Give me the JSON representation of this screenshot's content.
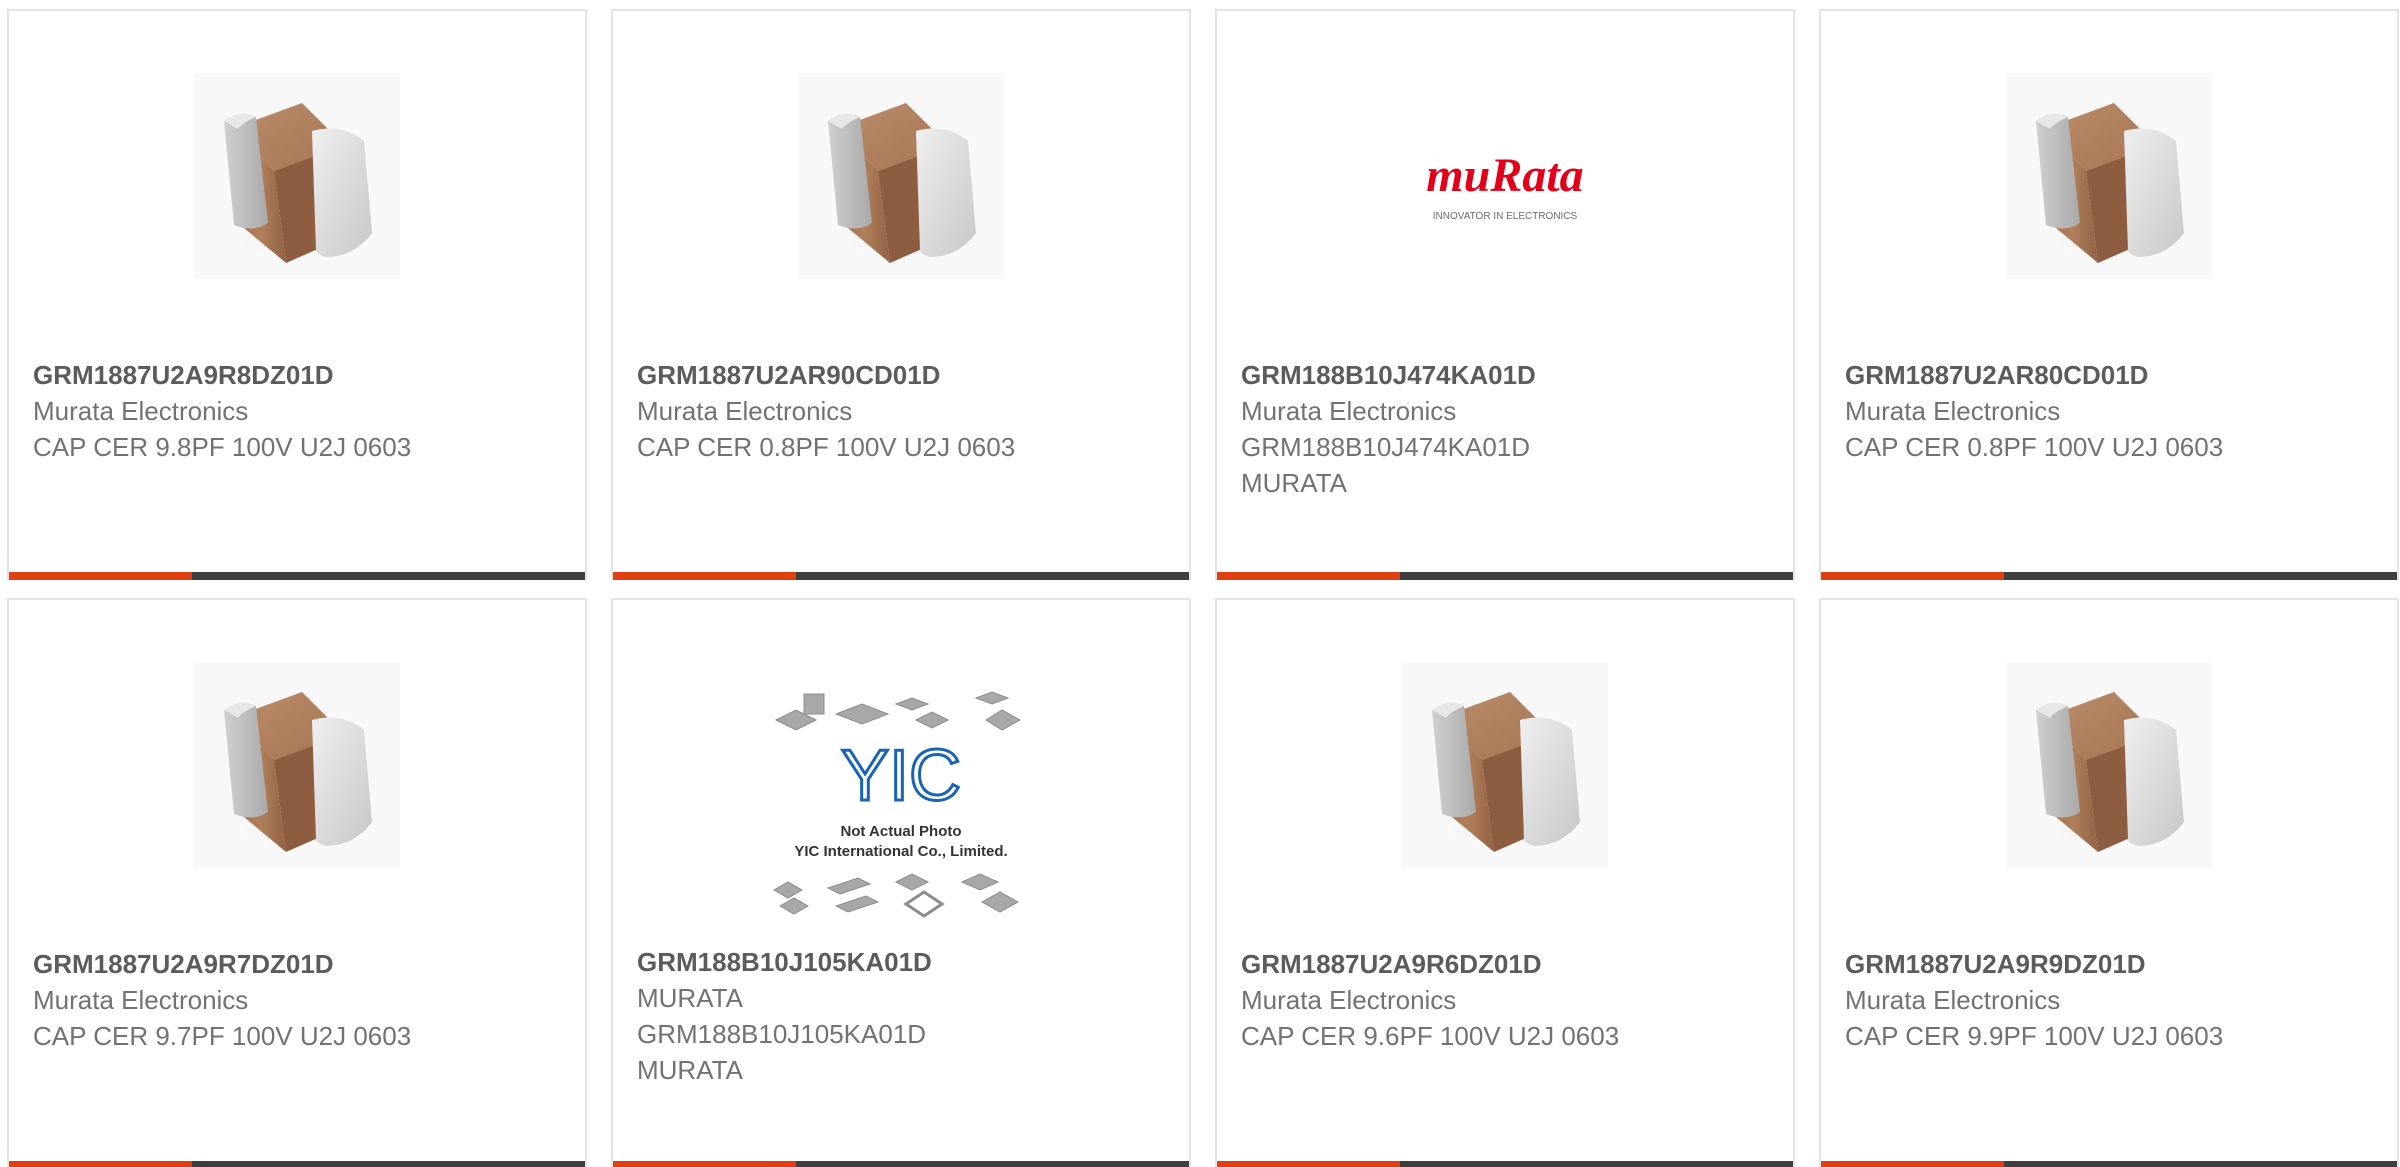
{
  "colors": {
    "accent_bar": "#e13f12",
    "dark_bar": "#3e3e3e",
    "part_number_text": "#5b5b5b",
    "detail_text": "#727272",
    "card_border": "#e4e4e4"
  },
  "products": [
    {
      "image": "capacitor-chip-image",
      "part_number": "GRM1887U2A9R8DZ01D",
      "lines": [
        "Murata Electronics",
        "CAP CER 9.8PF 100V U2J 0603"
      ]
    },
    {
      "image": "capacitor-chip-image",
      "part_number": "GRM1887U2AR90CD01D",
      "lines": [
        "Murata Electronics",
        "CAP CER 0.8PF 100V U2J 0603"
      ]
    },
    {
      "image": "murata-logo",
      "logo_text": "muRata",
      "logo_tagline": "INNOVATOR IN ELECTRONICS",
      "part_number": "GRM188B10J474KA01D",
      "lines": [
        "Murata Electronics",
        "GRM188B10J474KA01D",
        "MURATA"
      ]
    },
    {
      "image": "capacitor-chip-image",
      "part_number": "GRM1887U2AR80CD01D",
      "lines": [
        "Murata Electronics",
        "CAP CER 0.8PF 100V U2J 0603"
      ]
    },
    {
      "image": "capacitor-chip-image",
      "part_number": "GRM1887U2A9R7DZ01D",
      "lines": [
        "Murata Electronics",
        "CAP CER 9.7PF 100V U2J 0603"
      ]
    },
    {
      "image": "not-actual-photo-placeholder",
      "placeholder_logo": "YIC",
      "placeholder_line_1": "Not Actual Photo",
      "placeholder_line_2": "YIC International Co., Limited.",
      "part_number": "GRM188B10J105KA01D",
      "lines": [
        "MURATA",
        "GRM188B10J105KA01D",
        "MURATA"
      ]
    },
    {
      "image": "capacitor-chip-image",
      "part_number": "GRM1887U2A9R6DZ01D",
      "lines": [
        "Murata Electronics",
        "CAP CER 9.6PF 100V U2J 0603"
      ]
    },
    {
      "image": "capacitor-chip-image",
      "part_number": "GRM1887U2A9R9DZ01D",
      "lines": [
        "Murata Electronics",
        "CAP CER 9.9PF 100V U2J 0603"
      ]
    }
  ]
}
